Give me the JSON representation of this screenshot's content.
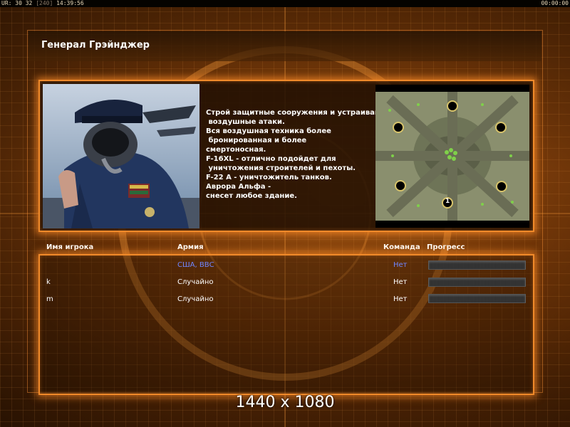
{
  "status_bar": {
    "left_a": "UR: 30 32",
    "left_b": "[240]",
    "clock": "14:39:56",
    "right": "00:00:00"
  },
  "general": {
    "title": "Генерал Грэйнджер",
    "brief": "Строй защитные сооружения и устраивай\n воздушные атаки.\nВся воздушная техника более\n бронированная и более\nсмертоносная.\nF-16XL - отлично подойдет для\n уничтожения строителей и пехоты.\nF-22 A - уничтожитель танков.\nАврора Альфа -\nснесет любое здание."
  },
  "minimap": {
    "start_marker_label": "1"
  },
  "table": {
    "headers": {
      "player": "Имя игрока",
      "army": "Армия",
      "team": "Команда",
      "progress": "Прогресс"
    },
    "rows": [
      {
        "player": "",
        "army": "США, ВВС",
        "team": "Нет",
        "progress": 0,
        "highlight": true
      },
      {
        "player": "k",
        "army": "Случайно",
        "team": "Нет",
        "progress": 0,
        "highlight": false
      },
      {
        "player": "m",
        "army": "Случайно",
        "team": "Нет",
        "progress": 0,
        "highlight": false
      }
    ]
  },
  "resolution_label": "1440 x 1080",
  "colors": {
    "accent": "#f08a2a",
    "local_player": "#6f86ff",
    "text": "#ffffff"
  }
}
